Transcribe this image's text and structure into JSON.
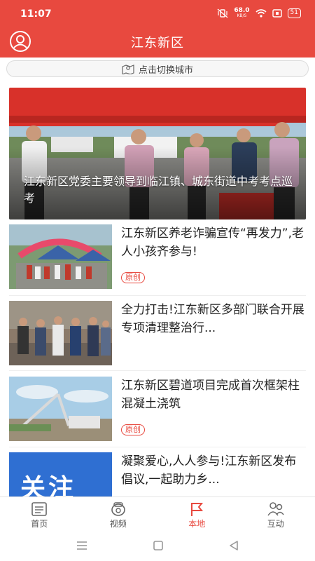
{
  "status_bar": {
    "time": "11:07",
    "net_speed": "68.0",
    "net_unit": "KB/S",
    "battery": "51"
  },
  "header": {
    "title": "江东新区"
  },
  "city_switch": {
    "label": "点击切换城市"
  },
  "hero": {
    "title": "江东新区党委主要领导到临江镇、城东街道中考考点巡考"
  },
  "news": [
    {
      "title": "江东新区养老诈骗宣传“再发力”,老人小孩齐参与!",
      "tag": "原创"
    },
    {
      "title": "全力打击!江东新区多部门联合开展专项清理整治行...",
      "tag": ""
    },
    {
      "title": "江东新区碧道项目完成首次框架柱混凝土浇筑",
      "tag": "原创"
    },
    {
      "title": "凝聚爱心,人人参与!江东新区发布倡议,一起助力乡...",
      "tag": "",
      "thumb_text": "关注"
    }
  ],
  "bottom_nav": [
    {
      "label": "首页",
      "icon": "newspaper-icon"
    },
    {
      "label": "视频",
      "icon": "video-icon"
    },
    {
      "label": "本地",
      "icon": "flag-icon",
      "active": true
    },
    {
      "label": "互动",
      "icon": "people-icon"
    }
  ],
  "colors": {
    "brand_red": "#e8493f",
    "header_text": "#ffffff",
    "tag_red": "#e8493f"
  }
}
